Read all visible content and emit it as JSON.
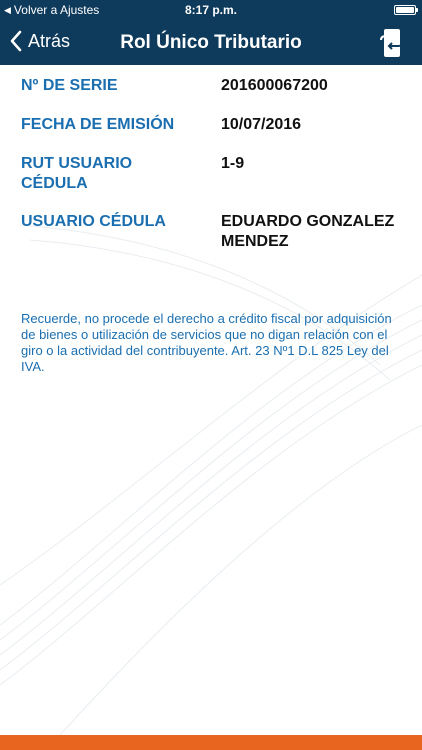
{
  "status_bar": {
    "back_label": "Volver a Ajustes",
    "time": "8:17 p.m."
  },
  "nav": {
    "back_label": "Atrás",
    "title": "Rol Único Tributario",
    "action_icon": "card-flip-icon"
  },
  "fields": [
    {
      "label": "Nº DE SERIE",
      "value": "201600067200"
    },
    {
      "label": "FECHA DE EMISIÓN",
      "value": "10/07/2016"
    },
    {
      "label": "RUT USUARIO CÉDULA",
      "value": "1-9"
    },
    {
      "label": "USUARIO CÉDULA",
      "value": "EDUARDO GONZALEZ MENDEZ"
    }
  ],
  "notice": "Recuerde, no procede el derecho a crédito fiscal por adquisición de bienes o utilización de servicios que no digan relación con el giro o la actividad del contribuyente. Art. 23 Nº1 D.L 825 Ley del IVA.",
  "colors": {
    "nav_background": "#0e3a5b",
    "label_blue": "#1b6fb0",
    "bottom_bar": "#e8651f"
  }
}
